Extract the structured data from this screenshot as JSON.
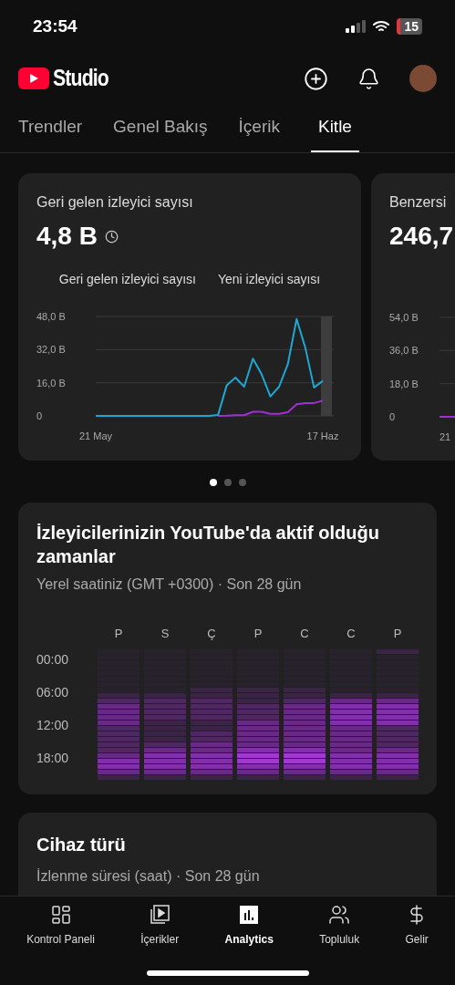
{
  "status_bar": {
    "time": "23:54",
    "battery": "15"
  },
  "header": {
    "logo_text": "Studio"
  },
  "tabs": [
    {
      "label": "Trendler",
      "selected": false
    },
    {
      "label": "Genel Bakış",
      "selected": false
    },
    {
      "label": "İçerik",
      "selected": false
    },
    {
      "label": "Kitle",
      "selected": true
    }
  ],
  "cards": [
    {
      "title": "Geri gelen izleyici sayısı",
      "value": "4,8 B",
      "chart_data": {
        "type": "line",
        "ylim": [
          0,
          48
        ],
        "yticks": [
          {
            "value": 0,
            "label": "0"
          },
          {
            "value": 16,
            "label": "16,0 B"
          },
          {
            "value": 32,
            "label": "32,0 B"
          },
          {
            "value": 48,
            "label": "48,0 B"
          }
        ],
        "categories": [
          "21 May",
          null,
          null,
          null,
          null,
          null,
          null,
          null,
          null,
          null,
          null,
          null,
          null,
          null,
          null,
          null,
          null,
          null,
          null,
          null,
          null,
          null,
          null,
          null,
          null,
          null,
          "17 Haz"
        ],
        "series": [
          {
            "name": "Geri gelen izleyici sayısı",
            "color": "#1ea7d2",
            "values": [
              0,
              0,
              0,
              0,
              0,
              0,
              0,
              0,
              0,
              0,
              0,
              0,
              0,
              0,
              0.4,
              14.8,
              18.5,
              14.1,
              27.6,
              20,
              9.4,
              14.1,
              25,
              46.8,
              33,
              13.7,
              16.9
            ]
          },
          {
            "name": "Yeni izleyici sayısı",
            "color": "#a22fd6",
            "values": [
              null,
              null,
              null,
              null,
              null,
              null,
              null,
              null,
              null,
              null,
              null,
              null,
              null,
              null,
              0,
              0.1,
              0.3,
              0.3,
              2,
              2,
              1,
              1,
              1.8,
              5.6,
              6.2,
              6.2,
              7.3
            ]
          }
        ]
      }
    },
    {
      "title": "Benzersi",
      "value": "246,7",
      "y_axis_labels": [
        "54,0 B",
        "36,0 B",
        "18,0 B",
        "0"
      ],
      "x_axis_label": "21"
    }
  ],
  "pager_dots": [
    {
      "selected": true
    },
    {
      "selected": false
    },
    {
      "selected": false
    }
  ],
  "active_times": {
    "title": "İzleyicilerinizin YouTube'da aktif olduğu zamanlar",
    "subtitle": "Yerel saatiniz (GMT +0300) · Son 28 gün",
    "days": [
      "P",
      "S",
      "Ç",
      "P",
      "C",
      "C",
      "P"
    ],
    "hours": [
      "00:00",
      "06:00",
      "12:00",
      "18:00"
    ]
  },
  "device_card": {
    "title": "Cihaz türü",
    "subtitle": "İzlenme süresi (saat) · Son 28 gün"
  },
  "bottom_nav": [
    {
      "label": "Kontrol Paneli",
      "selected": false
    },
    {
      "label": "İçerikler",
      "selected": false
    },
    {
      "label": "Analytics",
      "selected": true
    },
    {
      "label": "Topluluk",
      "selected": false
    },
    {
      "label": "Gelir",
      "selected": false
    }
  ]
}
